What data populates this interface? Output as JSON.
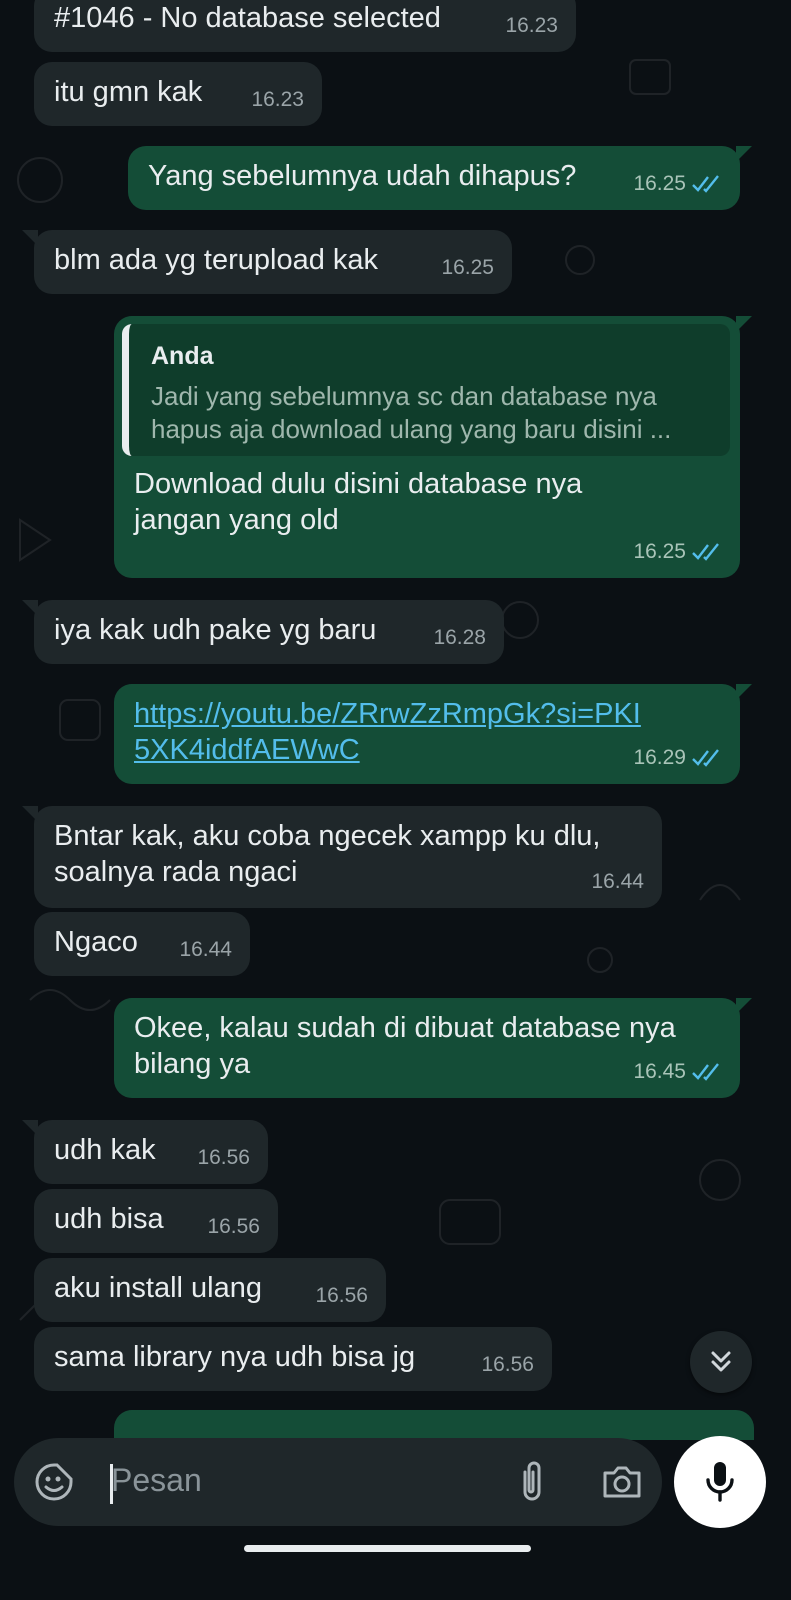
{
  "messages": [
    {
      "text": "#1046 - No database selected",
      "time": "16.23"
    },
    {
      "text": "itu gmn kak",
      "time": "16.23"
    },
    {
      "text": "Yang sebelumnya udah dihapus?",
      "time": "16.25"
    },
    {
      "text": "blm ada yg terupload kak",
      "time": "16.25"
    },
    {
      "quote_author": "Anda",
      "quote_text": "Jadi yang sebelumnya sc dan database nya hapus aja download ulang yang baru disini ...",
      "text": "Download dulu disini database nya jangan yang old",
      "time": "16.25"
    },
    {
      "text": "iya kak udh pake yg baru",
      "time": "16.28"
    },
    {
      "text": "https://youtu.be/ZRrwZzRmpGk?si=PKI5XK4iddfAEWwC",
      "time": "16.29"
    },
    {
      "text": "Bntar kak, aku coba ngecek xampp ku dlu, soalnya rada ngaci",
      "time": "16.44"
    },
    {
      "text": "Ngaco",
      "time": "16.44"
    },
    {
      "text": "Okee, kalau sudah di dibuat database nya bilang ya",
      "time": "16.45"
    },
    {
      "text": "udh kak",
      "time": "16.56"
    },
    {
      "text": "udh bisa",
      "time": "16.56"
    },
    {
      "text": "aku install ulang",
      "time": "16.56"
    },
    {
      "text": "sama library nya udh bisa jg",
      "time": "16.56"
    }
  ],
  "composer": {
    "placeholder": "Pesan"
  },
  "icons": {
    "emoji": "sticker-emoji-icon",
    "attach": "paperclip-icon",
    "camera": "camera-icon",
    "mic": "microphone-icon",
    "scroll": "double-chevron-down-icon",
    "read": "double-check-icon"
  },
  "colors": {
    "background": "#0b1014",
    "incoming_bubble": "#1f272a",
    "outgoing_bubble": "#144d37",
    "read_ticks": "#53bdeb",
    "link": "#53bdeb"
  }
}
